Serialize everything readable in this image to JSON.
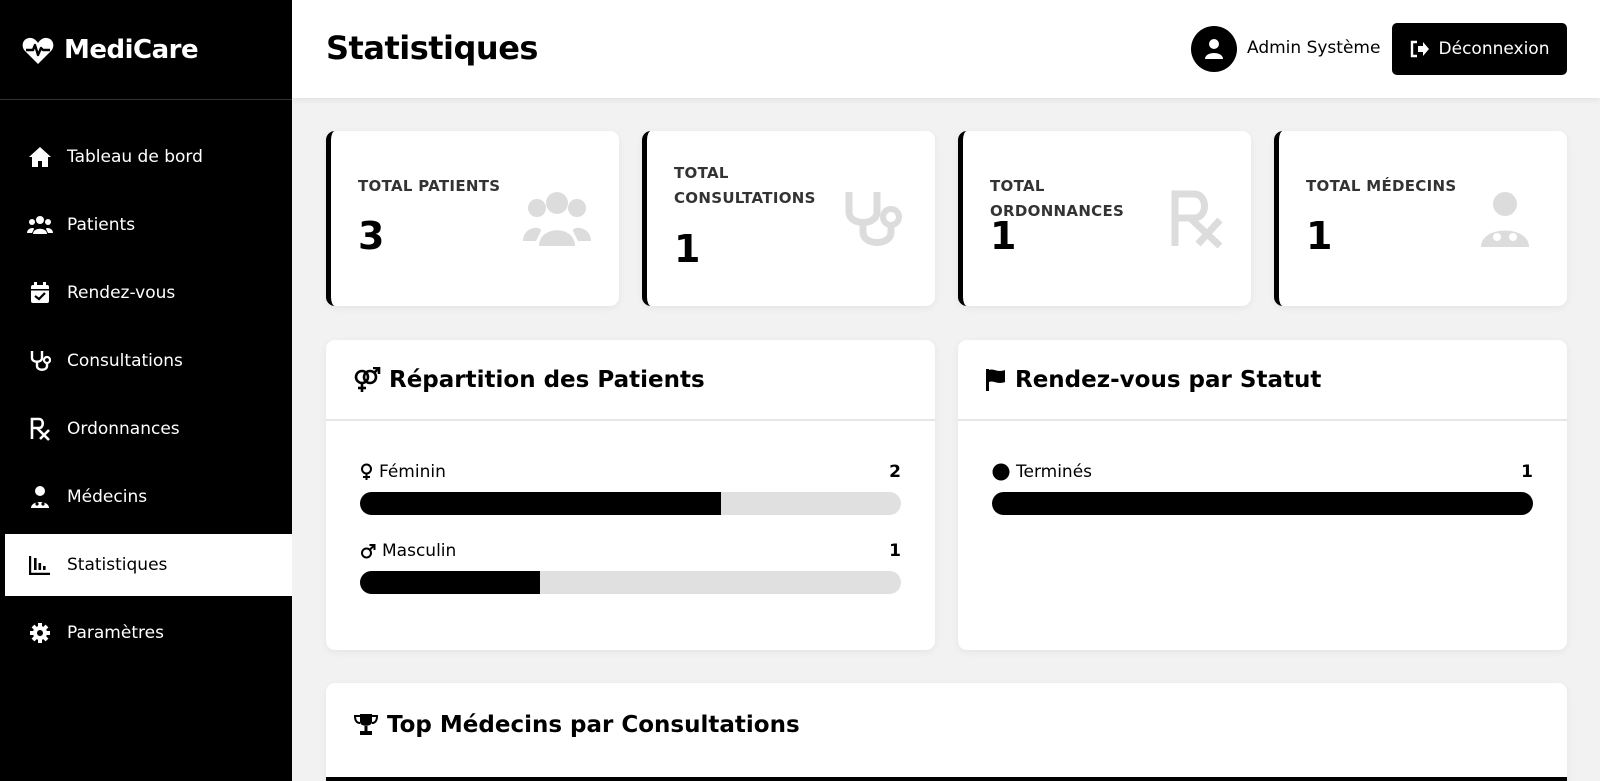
{
  "brand": {
    "name": "MediCare"
  },
  "sidebar": {
    "items": [
      {
        "label": "Tableau de bord",
        "icon": "home-icon",
        "active": false
      },
      {
        "label": "Patients",
        "icon": "users-icon",
        "active": false
      },
      {
        "label": "Rendez-vous",
        "icon": "calendar-check-icon",
        "active": false
      },
      {
        "label": "Consultations",
        "icon": "stethoscope-icon",
        "active": false
      },
      {
        "label": "Ordonnances",
        "icon": "prescription-icon",
        "active": false
      },
      {
        "label": "Médecins",
        "icon": "doctor-icon",
        "active": false
      },
      {
        "label": "Statistiques",
        "icon": "chart-icon",
        "active": true
      },
      {
        "label": "Paramètres",
        "icon": "gear-icon",
        "active": false
      }
    ]
  },
  "header": {
    "title": "Statistiques",
    "user_name": "Admin Système",
    "logout_label": "Déconnexion"
  },
  "stats": [
    {
      "label": "TOTAL PATIENTS",
      "value": "3",
      "icon": "users-icon"
    },
    {
      "label": "TOTAL CONSULTATIONS",
      "value": "1",
      "icon": "stethoscope-icon"
    },
    {
      "label": "TOTAL ORDONNANCES",
      "value": "1",
      "icon": "prescription-icon"
    },
    {
      "label": "TOTAL MÉDECINS",
      "value": "1",
      "icon": "doctor-icon"
    }
  ],
  "patients_panel": {
    "title": "Répartition des Patients",
    "rows": [
      {
        "label": "Féminin",
        "count": "2",
        "fraction": 0.667,
        "icon": "venus-icon"
      },
      {
        "label": "Masculin",
        "count": "1",
        "fraction": 0.333,
        "icon": "mars-icon"
      }
    ]
  },
  "rdv_panel": {
    "title": "Rendez-vous par Statut",
    "rows": [
      {
        "label": "Terminés",
        "count": "1",
        "fraction": 1.0,
        "icon": "circle-icon"
      }
    ]
  },
  "top_panel": {
    "title": "Top Médecins par Consultations"
  },
  "colors": {
    "primary": "#000000",
    "background": "#f2f2f2",
    "muted_icon": "#dcdcdc",
    "track": "#e0e0e0"
  }
}
